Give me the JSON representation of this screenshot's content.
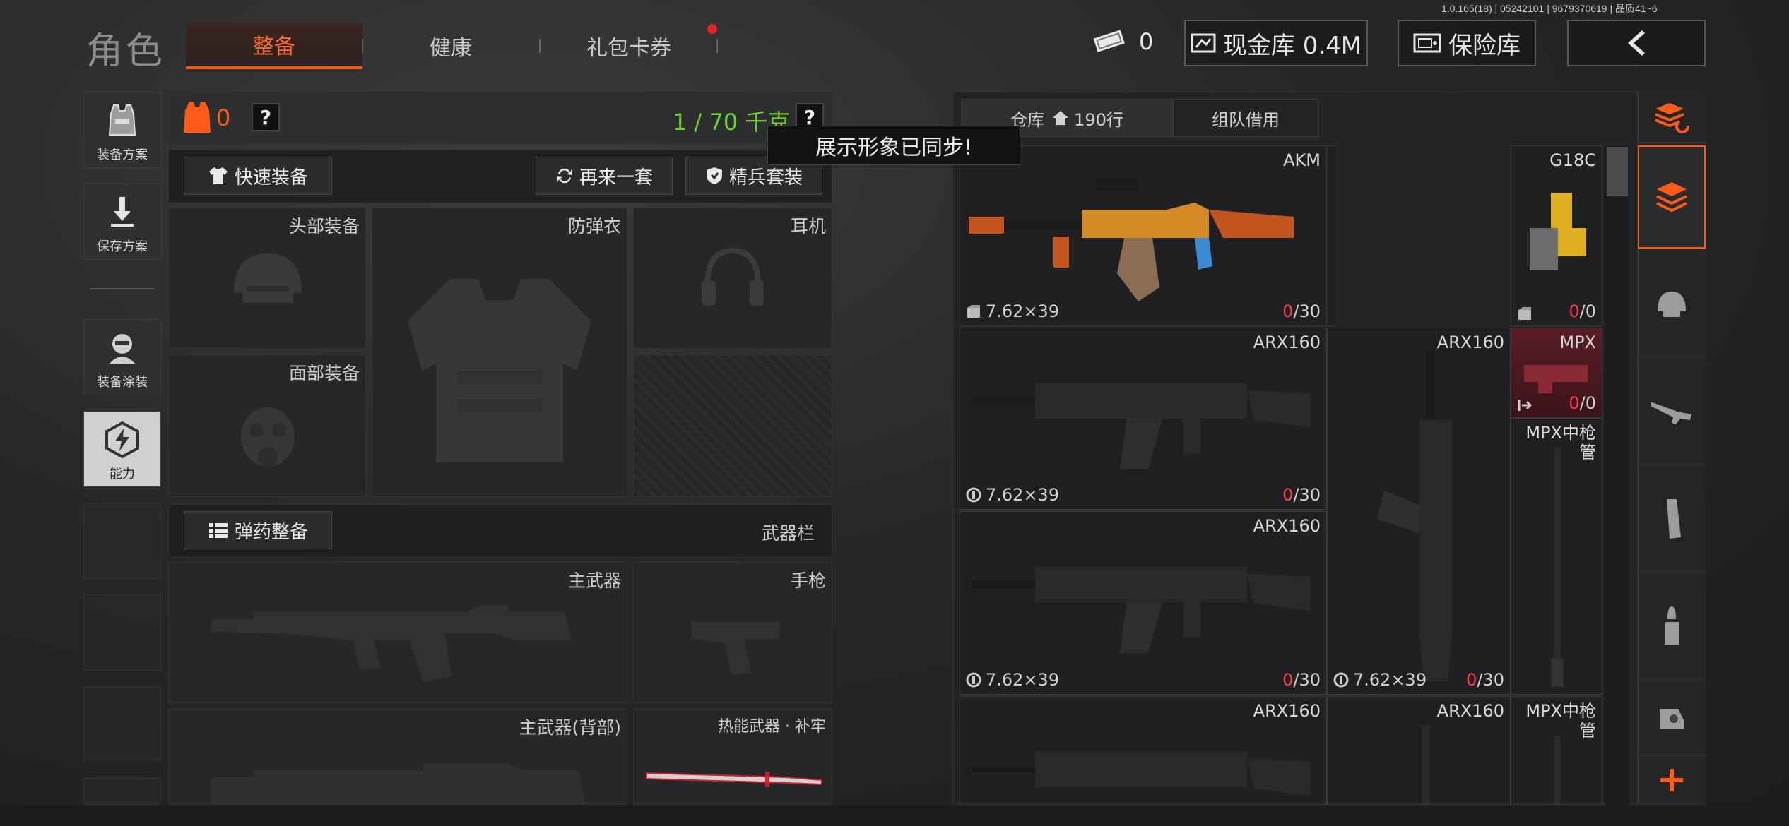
{
  "version": "1.0.165(18) | 05242101 | 9679370619 | 品质41~6",
  "header": {
    "title": "角色",
    "tabs": [
      {
        "label": "整备",
        "active": true
      },
      {
        "label": "健康",
        "active": false
      },
      {
        "label": "礼包卡券",
        "active": false
      }
    ],
    "tickets": "0",
    "cash_label": "现金库 0.4M",
    "safe_label": "保险库"
  },
  "sidebar": {
    "items": [
      {
        "label": "装备方案"
      },
      {
        "label": "保存方案"
      },
      {
        "label": "装备涂装"
      },
      {
        "label": "能力"
      }
    ]
  },
  "loadout": {
    "armor_count": "0",
    "weight": "1 / 70 千克",
    "quick_equip": "快速装备",
    "again": "再来一套",
    "elite": "精兵套装",
    "slots": {
      "head": "头部装备",
      "vest": "防弹衣",
      "earphone": "耳机",
      "face": "面部装备"
    },
    "ammo_btn": "弹药整备",
    "weapon_bar": "武器栏",
    "primary": "主武器",
    "pistol": "手枪",
    "primary_back": "主武器(背部)",
    "thermal": "热能武器 · 补牢"
  },
  "toast": "展示形象已同步!",
  "inventory": {
    "tab_storage": "仓库",
    "tab_rows": "190行",
    "tab_team": "组队借用",
    "items": [
      {
        "name": "AKM",
        "caliber": "7.62×39",
        "count_red": "0",
        "count_total": "/30"
      },
      {
        "name": "G18C",
        "count_red": "0",
        "count_total": "/0"
      },
      {
        "name": "ARX160",
        "caliber": "7.62×39",
        "count_red": "0",
        "count_total": "/30"
      },
      {
        "name": "ARX160",
        "caliber": "7.62×39",
        "count_red": "0",
        "count_total": "/30"
      },
      {
        "name": "MPX",
        "count_red": "0",
        "count_total": "/0"
      },
      {
        "name": "MPX中枪管"
      },
      {
        "name": "ARX160",
        "caliber": "7.62×39",
        "count_red": "0",
        "count_total": "/30"
      },
      {
        "name": "ARX160"
      },
      {
        "name": "ARX160"
      },
      {
        "name": "MPX中枪管"
      }
    ]
  }
}
